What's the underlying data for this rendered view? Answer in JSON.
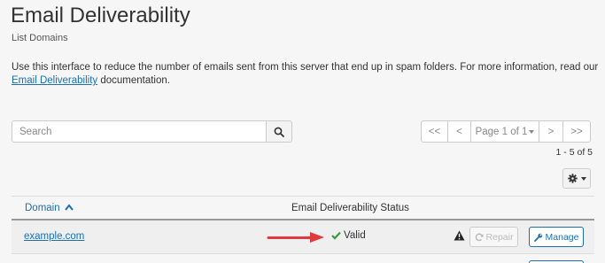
{
  "header": {
    "title": "Email Deliverability",
    "subtitle": "List Domains"
  },
  "description": {
    "text_before": "Use this interface to reduce the number of emails sent from this server that end up in spam folders. For more information, read our ",
    "link_text": "Email Deliverability",
    "text_after": " documentation."
  },
  "search": {
    "placeholder": "Search",
    "button_icon": "search-icon"
  },
  "pagination": {
    "first": "<<",
    "prev": "<",
    "page_label": "Page 1 of 1",
    "next": ">",
    "last": ">>",
    "range": "1 - 5 of 5"
  },
  "settings": {
    "icon": "gear-icon"
  },
  "table": {
    "columns": {
      "domain": "Domain",
      "status": "Email Deliverability Status"
    },
    "rows": [
      {
        "domain": "example.com",
        "status": "Valid",
        "repair_label": "Repair",
        "manage_label": "Manage"
      }
    ]
  },
  "colors": {
    "link": "#1a6fb5",
    "valid": "#3c9a3c",
    "arrow": "#e0393e",
    "background": "#f6f6f6"
  }
}
